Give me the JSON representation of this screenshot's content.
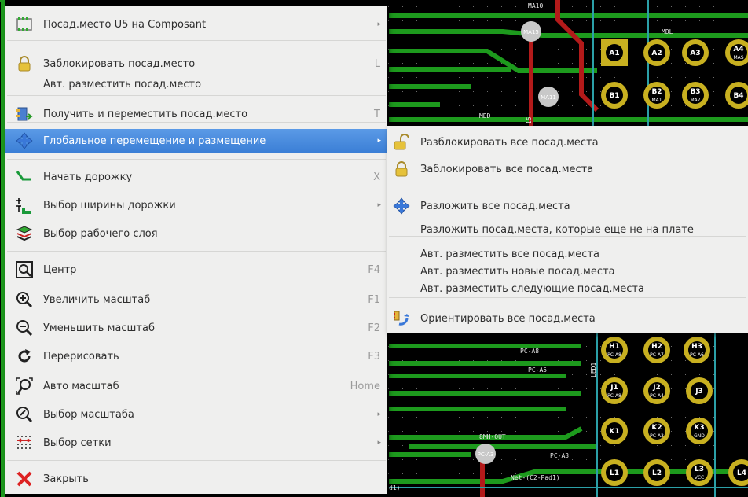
{
  "main_menu": {
    "items": [
      {
        "label": "Посад.место U5 на Composant",
        "shortcut": "",
        "submenu": true,
        "icon": "footprint-icon"
      },
      {
        "label": "Заблокировать посад.место",
        "shortcut": "L",
        "submenu": false,
        "icon": "lock-icon"
      },
      {
        "label": "Авт. разместить посад.место",
        "shortcut": "",
        "submenu": false,
        "icon": ""
      },
      {
        "label": "Получить и переместить посад.место",
        "shortcut": "T",
        "submenu": false,
        "icon": "get-move-footprint-icon"
      },
      {
        "label": "Глобальное перемещение и размещение",
        "shortcut": "",
        "submenu": true,
        "icon": "move-arrows-icon",
        "highlighted": true
      },
      {
        "label": "Начать дорожку",
        "shortcut": "X",
        "submenu": false,
        "icon": "track-icon"
      },
      {
        "label": "Выбор ширины дорожки",
        "shortcut": "",
        "submenu": true,
        "icon": "track-width-icon"
      },
      {
        "label": "Выбор рабочего слоя",
        "shortcut": "",
        "submenu": false,
        "icon": "layers-icon"
      },
      {
        "label": "Центр",
        "shortcut": "F4",
        "submenu": false,
        "icon": "zoom-center-icon"
      },
      {
        "label": "Увеличить масштаб",
        "shortcut": "F1",
        "submenu": false,
        "icon": "zoom-in-icon"
      },
      {
        "label": "Уменьшить масштаб",
        "shortcut": "F2",
        "submenu": false,
        "icon": "zoom-out-icon"
      },
      {
        "label": "Перерисовать",
        "shortcut": "F3",
        "submenu": false,
        "icon": "redraw-icon"
      },
      {
        "label": "Авто масштаб",
        "shortcut": "Home",
        "submenu": false,
        "icon": "zoom-auto-icon"
      },
      {
        "label": "Выбор масштаба",
        "shortcut": "",
        "submenu": true,
        "icon": "zoom-select-icon"
      },
      {
        "label": "Выбор сетки",
        "shortcut": "",
        "submenu": true,
        "icon": "grid-icon"
      },
      {
        "label": "Закрыть",
        "shortcut": "",
        "submenu": false,
        "icon": "close-icon"
      }
    ]
  },
  "sub_menu": {
    "items": [
      {
        "label": "Разблокировать все посад.места",
        "icon": "unlock-icon"
      },
      {
        "label": "Заблокировать все посад.места",
        "icon": "lock-icon"
      },
      {
        "label": "Разложить все посад.места",
        "icon": "move-arrows-icon"
      },
      {
        "label": "Разложить посад.места, которые еще не на плате",
        "icon": ""
      },
      {
        "label": "Авт. разместить все посад.места",
        "icon": ""
      },
      {
        "label": "Авт. разместить новые посад.места",
        "icon": ""
      },
      {
        "label": "Авт. разместить следующие посад.места",
        "icon": ""
      },
      {
        "label": "Ориентировать все посад.места",
        "icon": "orient-icon"
      }
    ]
  },
  "pcb": {
    "pads": [
      "A1",
      "A2",
      "A3",
      "A4",
      "B1",
      "B2",
      "B3",
      "B4",
      "H1",
      "H2",
      "H3",
      "J1",
      "J2",
      "J3",
      "K1",
      "K2",
      "K3",
      "L1",
      "L2",
      "L3",
      "L4"
    ],
    "pad_nets": {
      "B2": "MA1",
      "B3": "MA7",
      "A4": "MAS",
      "H1": "PC-A8",
      "H2": "PC-A7",
      "H3": "PC-A6",
      "J1": "PC-A8",
      "J2": "PC-A4",
      "K2": "PC-A3",
      "K3": "GND",
      "L3": "VCC"
    },
    "net_labels": [
      "MA10",
      "MA15",
      "MDL",
      "MA11",
      "MDD",
      "15",
      "PC-A8",
      "PC-A5",
      "LED1",
      "8MH-OUT",
      "PC-A3",
      "PC-A3",
      "Net-(C2-Pad1)",
      "d1)"
    ],
    "colors": {
      "board": "#000000",
      "track_green": "#1d9a1d",
      "track_red": "#b31a1a",
      "track_cyan": "#2ba0a8",
      "pad_yellow": "#c8b020",
      "via_gray": "#c8c8c8"
    }
  }
}
